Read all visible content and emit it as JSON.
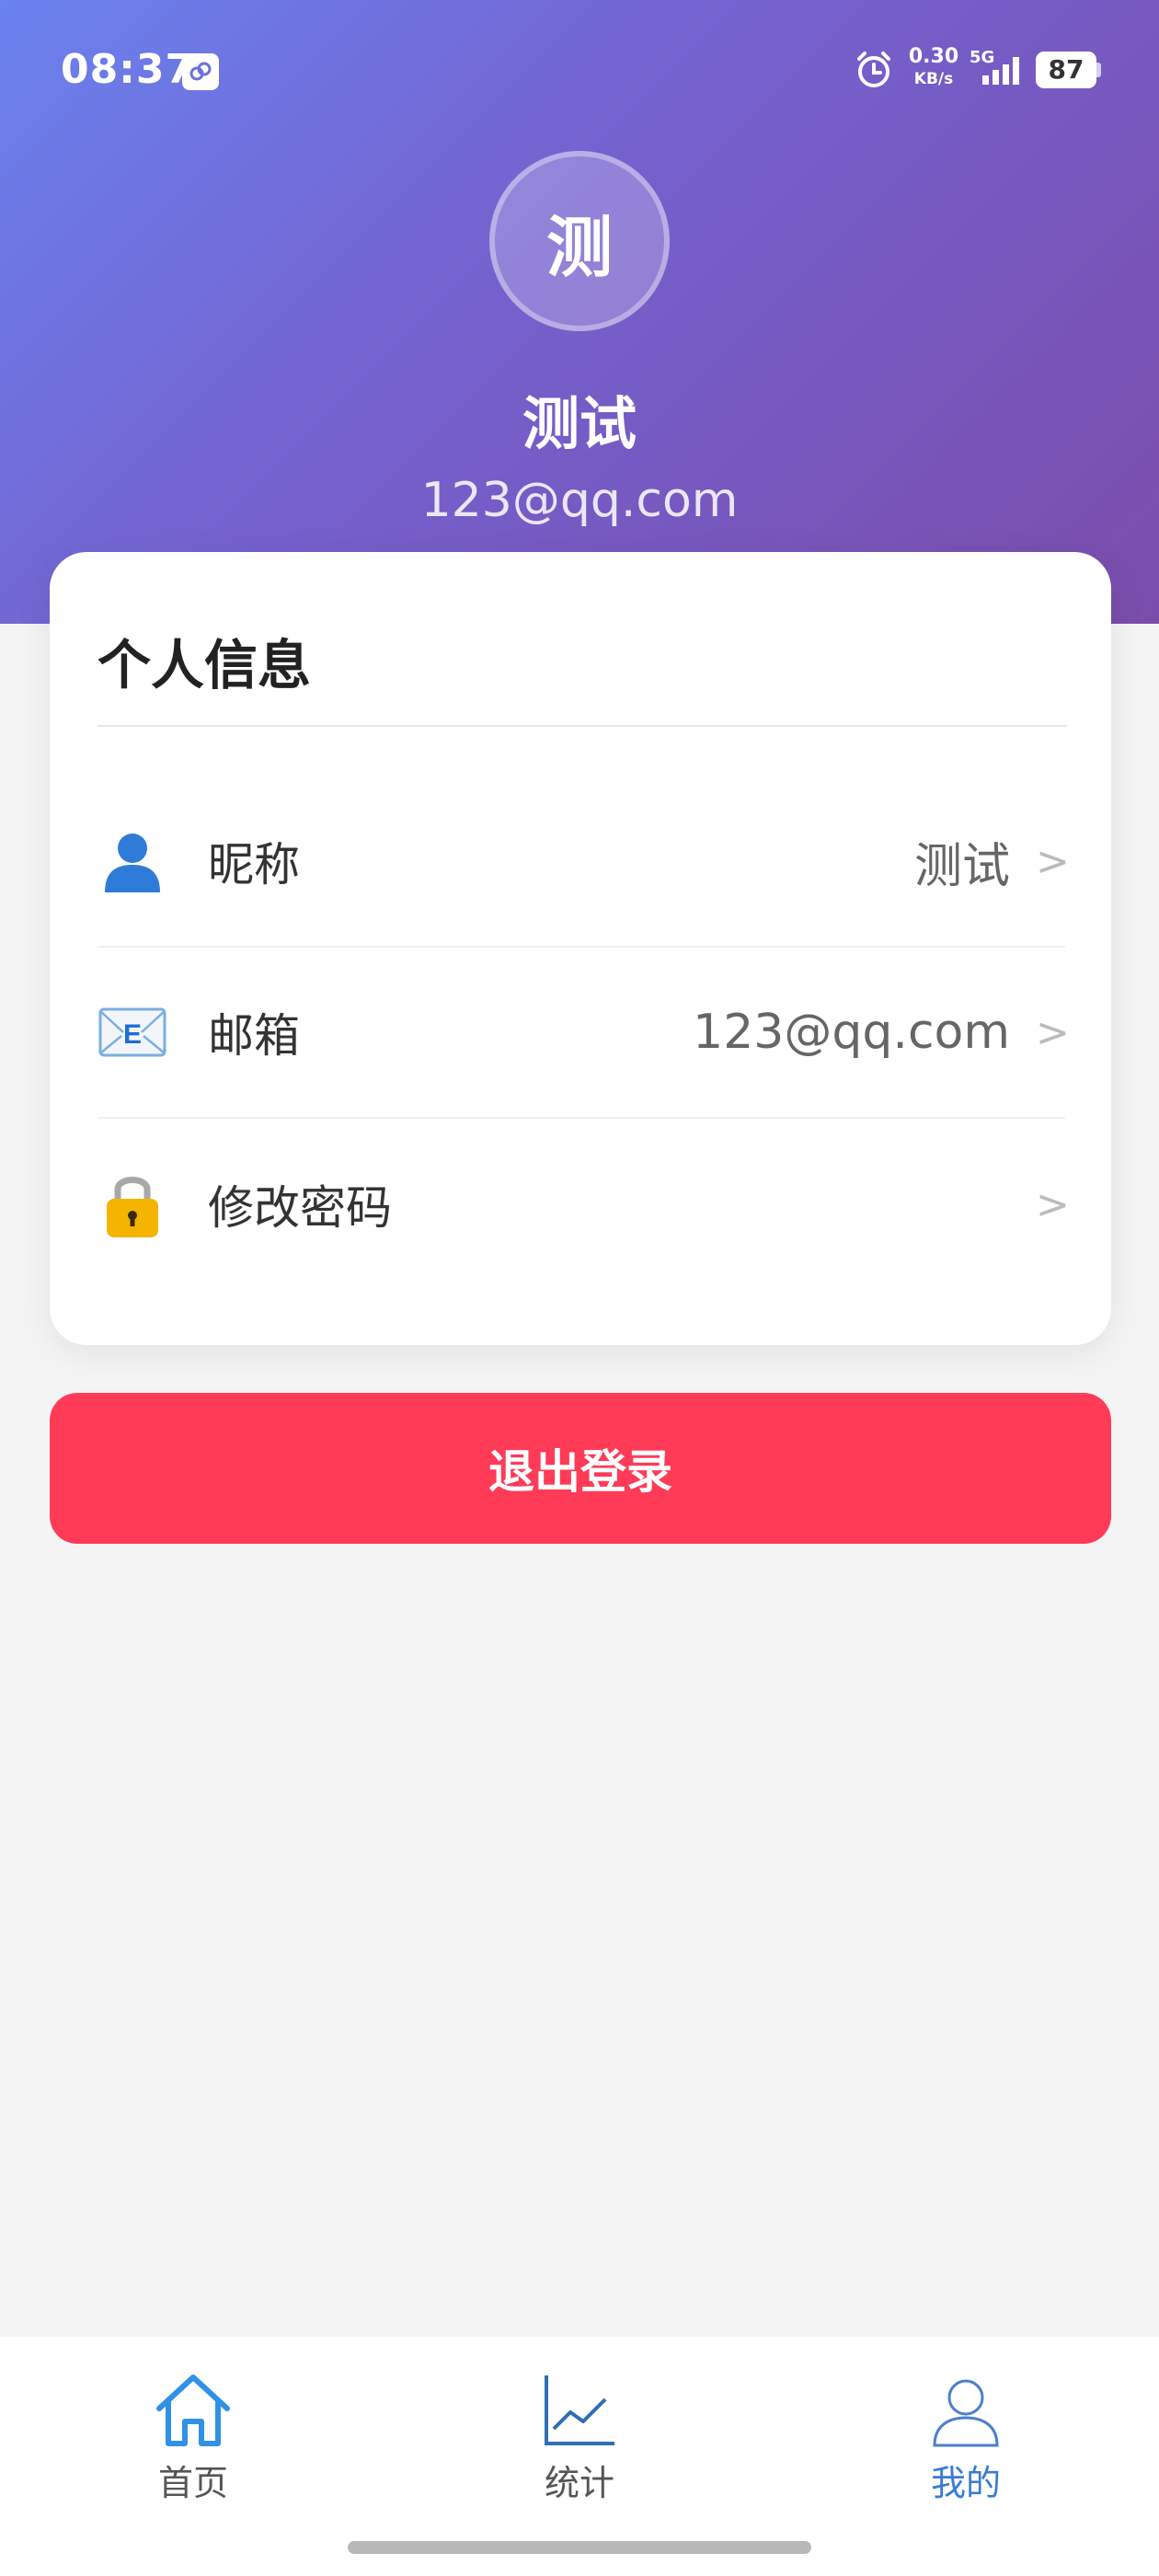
{
  "status_bar": {
    "time": "08:37",
    "net_speed_value": "0.30",
    "net_speed_unit": "KB/s",
    "network": "5G",
    "battery": "87"
  },
  "profile": {
    "avatar_char": "测",
    "name": "测试",
    "email": "123@qq.com"
  },
  "card": {
    "title": "个人信息",
    "rows": [
      {
        "label": "昵称",
        "value": "测试",
        "icon": "person-icon"
      },
      {
        "label": "邮箱",
        "value": "123@qq.com",
        "icon": "email-icon"
      },
      {
        "label": "修改密码",
        "value": "",
        "icon": "lock-icon"
      }
    ],
    "chevron": ">"
  },
  "logout_label": "退出登录",
  "nav": [
    {
      "label": "首页",
      "icon": "home-icon"
    },
    {
      "label": "统计",
      "icon": "chart-icon"
    },
    {
      "label": "我的",
      "icon": "profile-icon",
      "active": true
    }
  ],
  "colors": {
    "header_gradient_start": "#6a82ee",
    "header_gradient_end": "#7a4dab",
    "logout": "#ff3b58",
    "nav_active": "#3a7ad6"
  }
}
